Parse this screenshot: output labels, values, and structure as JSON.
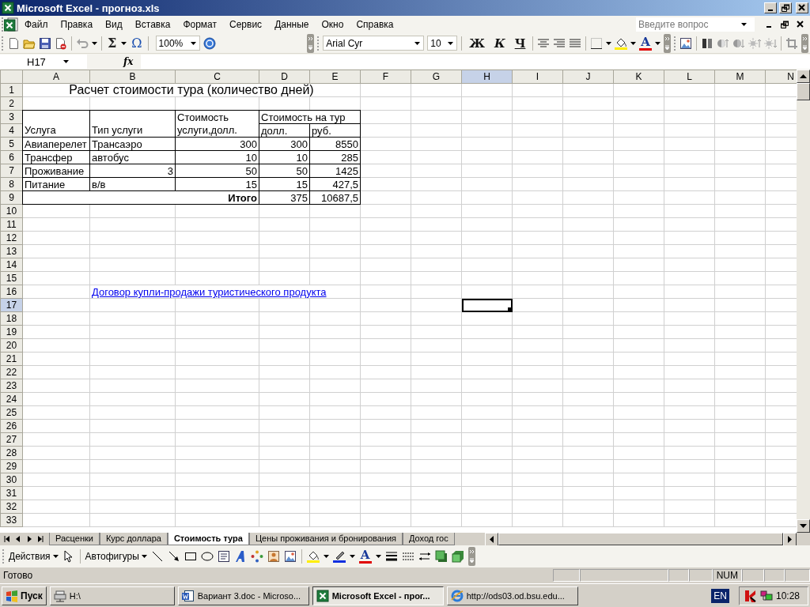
{
  "window": {
    "title": "Microsoft Excel - прогноз.xls"
  },
  "menu": [
    "Файл",
    "Правка",
    "Вид",
    "Вставка",
    "Формат",
    "Сервис",
    "Данные",
    "Окно",
    "Справка"
  ],
  "help_box": {
    "placeholder": "Введите вопрос"
  },
  "toolbar": {
    "sum": "Σ",
    "symbol": "Ω",
    "zoom": "100%",
    "font": "Arial Cyr",
    "size": "10",
    "font_color": "A",
    "format_buttons": [
      {
        "label": "Ж",
        "kind": "bold"
      },
      {
        "label": "К",
        "kind": "italic"
      },
      {
        "label": "Ч",
        "kind": "underline"
      }
    ]
  },
  "formula_bar": {
    "name_box": "H17",
    "fx": "fx"
  },
  "sheet": {
    "columns": [
      {
        "label": "A",
        "selected": false
      },
      {
        "label": "B",
        "selected": false
      },
      {
        "label": "C",
        "selected": false
      },
      {
        "label": "D",
        "selected": false
      },
      {
        "label": "E",
        "selected": false
      },
      {
        "label": "F",
        "selected": false
      },
      {
        "label": "G",
        "selected": false
      },
      {
        "label": "H",
        "selected": true
      },
      {
        "label": "I",
        "selected": false
      },
      {
        "label": "J",
        "selected": false
      },
      {
        "label": "K",
        "selected": false
      },
      {
        "label": "L",
        "selected": false
      },
      {
        "label": "M",
        "selected": false
      },
      {
        "label": "N",
        "selected": false
      }
    ],
    "rows": [
      {
        "number": "1",
        "selected": false,
        "cells": [
          {
            "kind": "title",
            "text": "Расчет стоимости тура (количество дней)"
          }
        ]
      },
      {
        "number": "2",
        "selected": false
      },
      {
        "number": "3",
        "selected": false,
        "cells": [
          {
            "kind": "header",
            "text": "Услуга",
            "boxed": true
          },
          {
            "kind": "header",
            "text": "Тип услуги",
            "boxed": true
          },
          {
            "kind": "header",
            "text": "Стоимость услуги,долл.",
            "boxed": true
          },
          {
            "kind": "group",
            "text": "Стоимость на тур",
            "boxed": true
          }
        ]
      },
      {
        "number": "4",
        "selected": false,
        "cells": [
          {
            "kind": "text",
            "text": "долл.",
            "boxed": true
          },
          {
            "kind": "text",
            "text": "руб.",
            "boxed": true
          }
        ]
      },
      {
        "number": "5",
        "selected": false,
        "cells": [
          {
            "kind": "text",
            "text": "Авиаперелет",
            "boxed": true
          },
          {
            "kind": "text",
            "text": "Трансаэро",
            "boxed": true
          },
          {
            "kind": "number",
            "text": "300",
            "boxed": true
          },
          {
            "kind": "number",
            "text": "300",
            "boxed": true
          },
          {
            "kind": "number",
            "text": "8550",
            "boxed": true
          }
        ]
      },
      {
        "number": "6",
        "selected": false,
        "cells": [
          {
            "kind": "text",
            "text": "Трансфер",
            "boxed": true
          },
          {
            "kind": "text",
            "text": "автобус",
            "boxed": true
          },
          {
            "kind": "number",
            "text": "10",
            "boxed": true
          },
          {
            "kind": "number",
            "text": "10",
            "boxed": true
          },
          {
            "kind": "number",
            "text": "285",
            "boxed": true
          }
        ]
      },
      {
        "number": "7",
        "selected": false,
        "cells": [
          {
            "kind": "text",
            "text": "Проживание",
            "boxed": true
          },
          {
            "kind": "number",
            "text": "3",
            "boxed": true
          },
          {
            "kind": "number",
            "text": "50",
            "boxed": true
          },
          {
            "kind": "number",
            "text": "50",
            "boxed": true
          },
          {
            "kind": "number",
            "text": "1425",
            "boxed": true
          }
        ]
      },
      {
        "number": "8",
        "selected": false,
        "cells": [
          {
            "kind": "text",
            "text": "Питание",
            "boxed": true
          },
          {
            "kind": "text",
            "text": "в/в",
            "boxed": true
          },
          {
            "kind": "number",
            "text": "15",
            "boxed": true
          },
          {
            "kind": "number",
            "text": "15",
            "boxed": true
          },
          {
            "kind": "number",
            "text": "427,5",
            "boxed": true
          }
        ]
      },
      {
        "number": "9",
        "selected": false,
        "cells": [
          {
            "kind": "total",
            "text": "Итого",
            "boxed": true
          },
          {
            "kind": "number",
            "text": "375",
            "boxed": true
          },
          {
            "kind": "number",
            "text": "10687,5",
            "boxed": true
          }
        ]
      },
      {
        "number": "10",
        "selected": false
      },
      {
        "number": "11",
        "selected": false
      },
      {
        "number": "12",
        "selected": false
      },
      {
        "number": "13",
        "selected": false
      },
      {
        "number": "14",
        "selected": false
      },
      {
        "number": "15",
        "selected": false
      },
      {
        "number": "16",
        "selected": false,
        "cells": [
          {
            "kind": "empty"
          },
          {
            "kind": "link",
            "text": "Договор купли-продажи туристического продукта"
          }
        ]
      },
      {
        "number": "17",
        "selected": true
      },
      {
        "number": "18",
        "selected": false
      },
      {
        "number": "19",
        "selected": false
      },
      {
        "number": "20",
        "selected": false
      },
      {
        "number": "21",
        "selected": false
      },
      {
        "number": "22",
        "selected": false
      },
      {
        "number": "23",
        "selected": false
      },
      {
        "number": "24",
        "selected": false
      },
      {
        "number": "25",
        "selected": false
      },
      {
        "number": "26",
        "selected": false
      },
      {
        "number": "27",
        "selected": false
      },
      {
        "number": "28",
        "selected": false
      },
      {
        "number": "29",
        "selected": false
      },
      {
        "number": "30",
        "selected": false
      },
      {
        "number": "31",
        "selected": false
      },
      {
        "number": "32",
        "selected": false
      },
      {
        "number": "33",
        "selected": false
      }
    ]
  },
  "sheet_tabs": [
    {
      "label": "Расценки",
      "selected": false
    },
    {
      "label": "Курс доллара",
      "selected": false
    },
    {
      "label": "Стоимость тура",
      "selected": true
    },
    {
      "label": "Цены проживания и бронирования",
      "selected": false
    },
    {
      "label": "Доход гос",
      "selected": false
    }
  ],
  "drawing_toolbar": {
    "actions": "Действия",
    "autoshapes": "Автофигуры",
    "font_color": "A"
  },
  "status_bar": {
    "text": "Готово",
    "indicator": "NUM"
  },
  "taskbar": {
    "start": "Пуск",
    "buttons": [
      {
        "label": "H:\\",
        "kind": "drive",
        "selected": false
      },
      {
        "label": "Вариант 3.doc - Microso...",
        "kind": "word",
        "selected": false
      },
      {
        "label": "Microsoft Excel - прог...",
        "kind": "excel",
        "selected": true
      },
      {
        "label": "http://ods03.od.bsu.edu...",
        "kind": "browser",
        "selected": false
      }
    ],
    "language": "EN",
    "clock": "10:28"
  }
}
